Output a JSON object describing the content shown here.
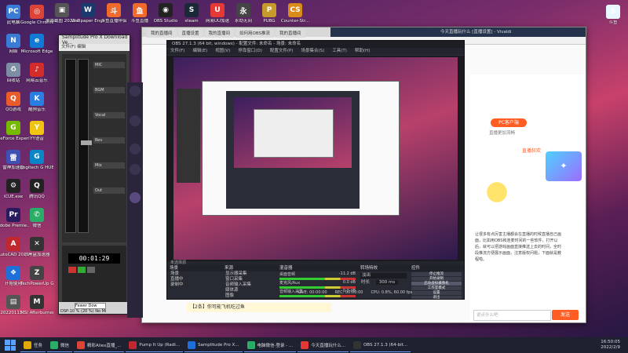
{
  "desktop_left": [
    {
      "label": "此电脑",
      "color": "#3a7bd5",
      "glyph": "PC"
    },
    {
      "label": "网络",
      "color": "#3a7bd5",
      "glyph": "N"
    },
    {
      "label": "回收站",
      "color": "#7d8da3",
      "glyph": "♻"
    },
    {
      "label": "QQ游戏",
      "color": "#e95b2b",
      "glyph": "Q"
    },
    {
      "label": "GeForce Experience",
      "color": "#76b900",
      "glyph": "G"
    },
    {
      "label": "雷神加速器",
      "color": "#3f51b5",
      "glyph": "雷"
    },
    {
      "label": "iCUE.exe",
      "color": "#222",
      "glyph": "⚙"
    },
    {
      "label": "Adobe Premie...",
      "color": "#2a1a5e",
      "glyph": "Pr"
    },
    {
      "label": "AutoCAD 2021",
      "color": "#c0282f",
      "glyph": "A"
    },
    {
      "label": "开始使用",
      "color": "#1e6fd9",
      "glyph": "❖"
    },
    {
      "label": "20220113...",
      "color": "#555",
      "glyph": "▤"
    }
  ],
  "desktop_col2": [
    {
      "label": "Google Chrome",
      "color": "#db4437",
      "glyph": "◎"
    },
    {
      "label": "Microsoft Edge",
      "color": "#0f7bd6",
      "glyph": "e"
    },
    {
      "label": "网易云音乐",
      "color": "#d42b2b",
      "glyph": "♪"
    },
    {
      "label": "酷狗音乐",
      "color": "#2a7de1",
      "glyph": "K"
    },
    {
      "label": "YY语音",
      "color": "#f1c40f",
      "glyph": "Y"
    },
    {
      "label": "Logitech G HUB",
      "color": "#0a85c7",
      "glyph": "G"
    },
    {
      "label": "腾讯QQ",
      "color": "#222",
      "glyph": "Q"
    },
    {
      "label": "微信",
      "color": "#2aae67",
      "glyph": "✆"
    },
    {
      "label": "小黑盒加速器",
      "color": "#333",
      "glyph": "✕"
    },
    {
      "label": "TechPowerUp GPU-Z",
      "color": "#444",
      "glyph": "Z"
    },
    {
      "label": "MSI Afterburner",
      "color": "#333",
      "glyph": "M"
    }
  ],
  "desktop_top": [
    {
      "label": "屏幕截图 2021-12-...",
      "color": "#555",
      "glyph": "▣"
    },
    {
      "label": "Wallpaper Engine:...",
      "color": "#1a3a6e",
      "glyph": "W"
    },
    {
      "label": "斗鱼直播伴侣",
      "color": "#f06a2c",
      "glyph": "斗"
    },
    {
      "label": "斗鱼直播",
      "color": "#f06a2c",
      "glyph": "鱼"
    },
    {
      "label": "OBS Studio",
      "color": "#222",
      "glyph": "◉"
    },
    {
      "label": "steam",
      "color": "#1b2838",
      "glyph": "S"
    },
    {
      "label": "网易UU加速",
      "color": "#e53935",
      "glyph": "U"
    },
    {
      "label": "永劫无间",
      "color": "#444",
      "glyph": "永"
    },
    {
      "label": "PUBG",
      "color": "#c79b2b",
      "glyph": "P"
    },
    {
      "label": "Counter-Str...",
      "color": "#d98c1a",
      "glyph": "CS"
    }
  ],
  "desktop_right": [
    {
      "label": "斗鱼",
      "color": "#e8f6ff",
      "glyph": "S"
    }
  ],
  "samplitude": {
    "title": "Samplitude Pro X Download Ve...",
    "menu": "文件(F)  编辑",
    "tracks": [
      "MIC",
      "BGM",
      "Vocal",
      "Rev",
      "Mix",
      "Out"
    ],
    "time": "00:01:29",
    "status": "DSP:10 %  (20 %) No Mi",
    "dropdown": "Fewer Dow"
  },
  "browser": {
    "tabs": [
      "我的直播间",
      "直播设置",
      "我的直播间",
      "如何用OBS推流",
      "我的直播间"
    ],
    "window_title": "今天直播玩什么 [直播设置] - Vivaldi"
  },
  "douyu_panel": {
    "pc_client": "PC客户端",
    "pc_sub": "直播更加流畅",
    "promo_title": "直播狂欢",
    "article_text": "让很多有点厉害主播都会在直播的时候直播自己画面，比如用OBS和连麦时间的一些软件，打开以后，就可以把游戏画面直接推送上去的时间，全时段推流方便展示画面，注意版权问题，下面就是教程啦。",
    "chat_hint": "说点什么吧",
    "send": "发送"
  },
  "obs": {
    "title": "OBS 27.1.3 (64 bit, windows) - 配置文件: 未命名 - 场景: 未命名",
    "menu": [
      "文件(F)",
      "编辑(E)",
      "视图(V)",
      "停靠窗口(D)",
      "配置文件(P)",
      "场景集合(S)",
      "工具(T)",
      "帮助(H)"
    ],
    "source_bar": "未选择源",
    "docks": {
      "scenes": {
        "title": "场景",
        "items": [
          "场景",
          "直播中",
          "录制中"
        ]
      },
      "sources": {
        "title": "来源",
        "items": [
          "显示器采集",
          "窗口采集",
          "音频输入采集",
          "媒体源",
          "图像"
        ]
      },
      "mixer": {
        "title": "混音器",
        "channels": [
          {
            "name": "桌面音频",
            "db": "-11.2 dB"
          },
          {
            "name": "麦克风/Aux",
            "db": "0.0 dB"
          },
          {
            "name": "音频输入采集",
            "db": "0.0 dB"
          }
        ]
      },
      "transitions": {
        "title": "转场特效",
        "type": "淡出",
        "duration_label": "时长",
        "duration": "300 ms"
      },
      "controls": {
        "title": "控件",
        "buttons": [
          "停止推流",
          "开始录制",
          "启动虚拟摄像机",
          "工作室模式",
          "设置",
          "退出"
        ]
      }
    },
    "status": {
      "live": "LIVE: 00:00:00",
      "rec": "REC: 00:00:00",
      "cpu": "CPU: 0.8%, 60.00 fps"
    }
  },
  "danmu": {
    "text": "【2条】你可能飞机吃过鱼"
  },
  "taskbar": {
    "apps": [
      {
        "label": "任务",
        "color": "#e0a800"
      },
      {
        "label": "微信",
        "color": "#2aae67"
      },
      {
        "label": "精彩Aliex直播_...",
        "color": "#db4437"
      },
      {
        "label": "Pump It Up (Radi...",
        "color": "#c0282f"
      },
      {
        "label": "Samplitude Pro X...",
        "color": "#1e6fd9"
      },
      {
        "label": "电脑微信-登录 - ...",
        "color": "#2aae67"
      },
      {
        "label": "今天直播玩什么...",
        "color": "#e53935"
      },
      {
        "label": "OBS 27.1.3 (64-bit...",
        "color": "#333"
      }
    ],
    "clock_time": "16:50:05",
    "clock_date": "2022/2/9"
  }
}
